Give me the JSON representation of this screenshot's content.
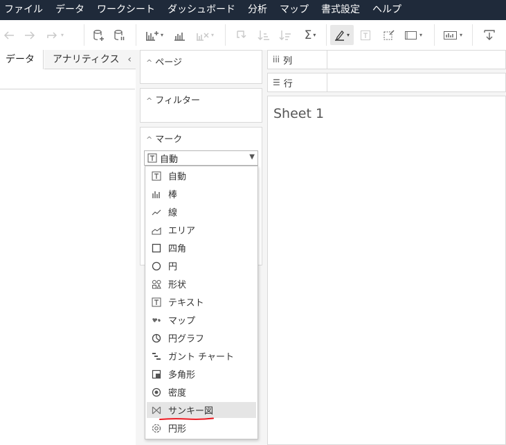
{
  "menubar": {
    "items": [
      "ファイル",
      "データ",
      "ワークシート",
      "ダッシュボード",
      "分析",
      "マップ",
      "書式設定",
      "ヘルプ"
    ]
  },
  "toolbar": {
    "icons": [
      "back-arrow-icon",
      "forward-arrow-icon",
      "redo-icon",
      "new-datasource-icon",
      "pause-update-icon",
      "new-worksheet-icon",
      "duplicate-sheet-icon",
      "clear-sheet-icon",
      "swap-rows-columns-icon",
      "sort-ascending-icon",
      "sort-descending-icon",
      "totals-icon",
      "highlight-icon",
      "show-mark-labels-icon",
      "fix-axes-icon",
      "fit-view-icon",
      "show-me-icon",
      "present-icon"
    ],
    "totals_symbol": "Σ"
  },
  "left_pane": {
    "tab_data": "データ",
    "tab_analytics": "アナリティクス",
    "collapse": "‹"
  },
  "cards": {
    "pages_title": "ページ",
    "filters_title": "フィルター",
    "marks_title": "マーク",
    "mark_type_selected": "自動"
  },
  "shelves": {
    "columns_label": "列",
    "rows_label": "行"
  },
  "view": {
    "sheet_title": "Sheet 1"
  },
  "mark_dropdown": {
    "options": [
      {
        "label": "自動",
        "icon": "text-box-icon"
      },
      {
        "label": "棒",
        "icon": "bar-icon"
      },
      {
        "label": "線",
        "icon": "line-icon"
      },
      {
        "label": "エリア",
        "icon": "area-icon"
      },
      {
        "label": "四角",
        "icon": "square-icon"
      },
      {
        "label": "円",
        "icon": "circle-icon"
      },
      {
        "label": "形状",
        "icon": "shapes-icon"
      },
      {
        "label": "テキスト",
        "icon": "text-box-icon"
      },
      {
        "label": "マップ",
        "icon": "map-icon"
      },
      {
        "label": "円グラフ",
        "icon": "pie-icon"
      },
      {
        "label": "ガント チャート",
        "icon": "gantt-icon"
      },
      {
        "label": "多角形",
        "icon": "polygon-icon"
      },
      {
        "label": "密度",
        "icon": "density-icon"
      },
      {
        "label": "サンキー図",
        "icon": "sankey-icon",
        "highlighted": true
      },
      {
        "label": "円形",
        "icon": "radial-icon"
      }
    ]
  },
  "colors": {
    "menubar_bg": "#1f2a3a",
    "highlight_bg": "#e5e5e5",
    "annotation_red": "#e8141c"
  }
}
